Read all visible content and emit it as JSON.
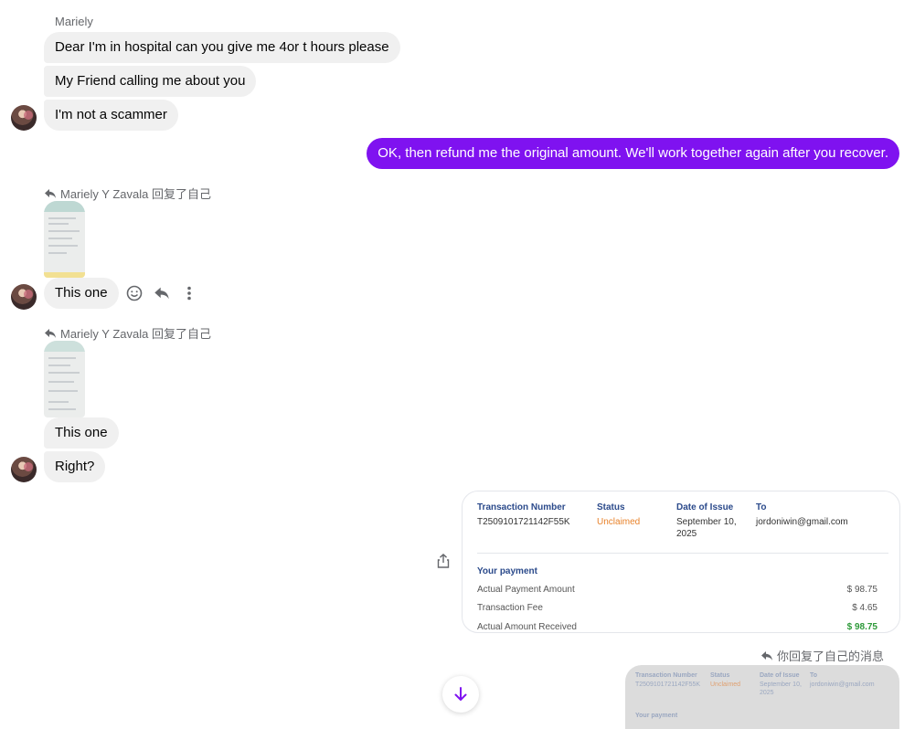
{
  "conversation": {
    "sender_name": "Mariely",
    "incoming_group_1": [
      "Dear I'm in hospital can you give me 4or t hours please",
      "My Friend calling me about you",
      "I'm not a scammer"
    ],
    "outgoing_1": "OK, then refund me the original amount. We'll work together again after you recover.",
    "reply_1_label": "Mariely Y Zavala 回复了自己",
    "reply_1_text": "This one",
    "reply_2_label": "Mariely Y Zavala 回复了自己",
    "reply_2_text": "This one",
    "incoming_right": "Right?",
    "self_reply_label": "你回复了自己的消息"
  },
  "receipt": {
    "headers": {
      "transaction_number": "Transaction Number",
      "status": "Status",
      "date_of_issue": "Date of Issue",
      "to": "To"
    },
    "values": {
      "transaction_number": "T2509101721142F55K",
      "status": "Unclaimed",
      "date_line1": "September 10,",
      "date_line2": "2025",
      "to": "jordoniwin@gmail.com"
    },
    "section_title": "Your payment",
    "rows": [
      {
        "label": "Actual Payment Amount",
        "value": "$ 98.75"
      },
      {
        "label": "Transaction Fee",
        "value": "$ 4.65"
      },
      {
        "label": "Actual Amount Received",
        "value": "$ 98.75"
      }
    ],
    "colors": {
      "header": "#2b4a8b",
      "status": "#e8822a",
      "received": "#2e9a3a"
    }
  },
  "ghost_preview": {
    "h1": "Transaction Number",
    "h2": "Status",
    "h3": "Date of Issue",
    "h4": "To",
    "v1": "T2509101721142F55K",
    "v2": "Unclaimed",
    "v3a": "September 10,",
    "v3b": "2025",
    "v4": "jordoniwin@gmail.com",
    "sec": "Your payment"
  },
  "icons": {
    "reply": "reply-icon",
    "emoji": "emoji-icon",
    "more": "more-vertical-icon",
    "share": "share-icon",
    "scroll_down": "arrow-down-icon"
  },
  "colors": {
    "outgoing_bubble": "#7f12f0",
    "incoming_bubble": "#f0f0f0",
    "scroll_arrow": "#7f12f0"
  }
}
